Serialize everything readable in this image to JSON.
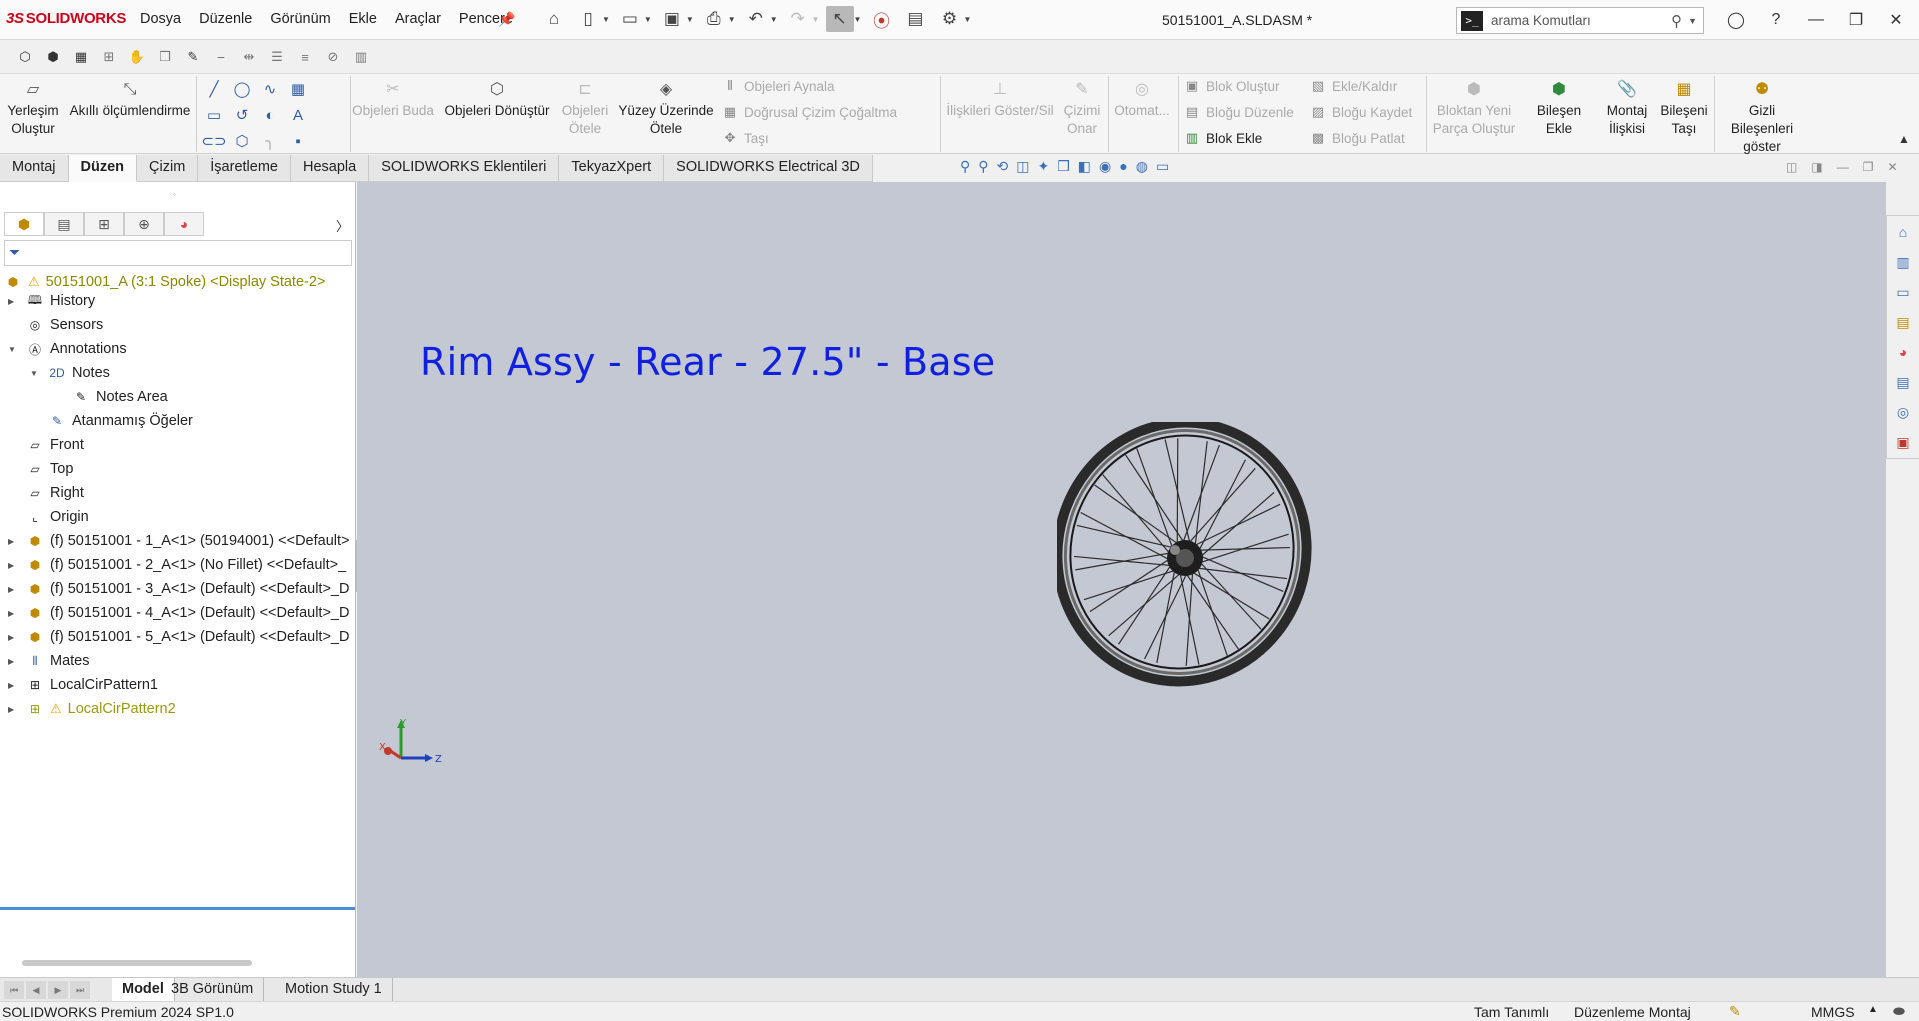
{
  "app": {
    "brand_ds": "3S",
    "brand_name": "SOLIDWORKS"
  },
  "menu": [
    "Dosya",
    "Düzenle",
    "Görünüm",
    "Ekle",
    "Araçlar",
    "Pencere"
  ],
  "document_title": "50151001_A.SLDASM *",
  "search": {
    "placeholder": "arama Komutları"
  },
  "ribbon": {
    "yerlesim": "Yerleşim Oluştur",
    "akilli": "Akıllı ölçümlendirme",
    "objeleri_buda": "Objeleri Buda",
    "objeleri_donustur": "Objeleri Dönüştür",
    "objeleri_otele": "Objeleri Ötele",
    "yuzey_uzerinde": "Yüzey Üzerinde Ötele",
    "objeleri_aynala": "Objeleri Aynala",
    "dogrusal": "Doğrusal Çizim Çoğaltma",
    "tasi": "Taşı",
    "iliskileri": "İlişkileri Göster/Sil",
    "cizimi_onar": "Çizimi Onar",
    "otomat": "Otomat...",
    "blok_olustur": "Blok Oluştur",
    "blogu_duzenle": "Bloğu Düzenle",
    "blok_ekle": "Blok Ekle",
    "ekle_kaldir": "Ekle/Kaldır",
    "blogu_kaydet": "Bloğu Kaydet",
    "blogu_patlat": "Bloğu Patlat",
    "bloktan_yeni": "Bloktan Yeni Parça Oluştur",
    "bilesen_ekle": "Bileşen Ekle",
    "montaj_iliskisi": "Montaj İlişkisi",
    "bileseni_tasi": "Bileşeni Taşı",
    "gizli_bilesenleri": "Gizli Bileşenleri göster"
  },
  "command_tabs": [
    "Montaj",
    "Düzen",
    "Çizim",
    "İşaretleme",
    "Hesapla",
    "SOLIDWORKS Eklentileri",
    "TekyazXpert",
    "SOLIDWORKS Electrical 3D"
  ],
  "active_tab": "Düzen",
  "tree": {
    "root": "50151001_A (3:1 Spoke) <Display State-2>",
    "items": [
      "History",
      "Sensors",
      "Annotations",
      "Notes",
      "Notes Area",
      "Atanmamış Öğeler",
      "Front",
      "Top",
      "Right",
      "Origin",
      "(f) 50151001 - 1_A<1> (50194001) <<Default>",
      "(f) 50151001 - 2_A<1> (No Fillet) <<Default>_",
      "(f) 50151001 - 3_A<1> (Default) <<Default>_D",
      "(f) 50151001 - 4_A<1> (Default) <<Default>_D",
      "(f) 50151001 - 5_A<1> (Default) <<Default>_D",
      "Mates",
      "LocalCirPattern1",
      "LocalCirPattern2"
    ]
  },
  "viewport": {
    "note_text": "Rim Assy - Rear - 27.5\" - Base",
    "triad": {
      "x": "X",
      "y": "Y",
      "z": "Z"
    }
  },
  "bottom_tabs": [
    "Model",
    "3B Görünüm",
    "Motion Study 1"
  ],
  "status": {
    "version": "SOLIDWORKS Premium 2024 SP1.0",
    "definition": "Tam Tanımlı",
    "mode": "Düzenleme Montaj",
    "units": "MMGS"
  }
}
